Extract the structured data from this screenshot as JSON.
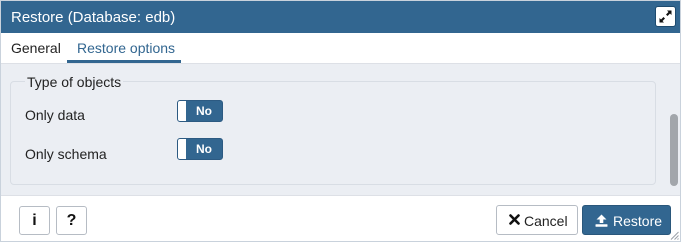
{
  "window": {
    "title": "Restore (Database: edb)",
    "maximize_icon": "expand-arrows-icon"
  },
  "tabs": [
    {
      "label": "General",
      "active": false
    },
    {
      "label": "Restore options",
      "active": true
    }
  ],
  "section": {
    "legend": "Type of objects",
    "fields": [
      {
        "label": "Only data",
        "toggle_value": "No"
      },
      {
        "label": "Only schema",
        "toggle_value": "No"
      }
    ]
  },
  "footer": {
    "info_glyph": "i",
    "info_icon": "info-icon",
    "help_glyph": "?",
    "help_icon": "question-icon",
    "cancel_label": "Cancel",
    "cancel_icon": "times-icon",
    "restore_label": "Restore",
    "restore_icon": "upload-icon"
  },
  "colors": {
    "primary": "#326690",
    "content_bg": "#ebeef3",
    "border": "#b6bcc4"
  }
}
